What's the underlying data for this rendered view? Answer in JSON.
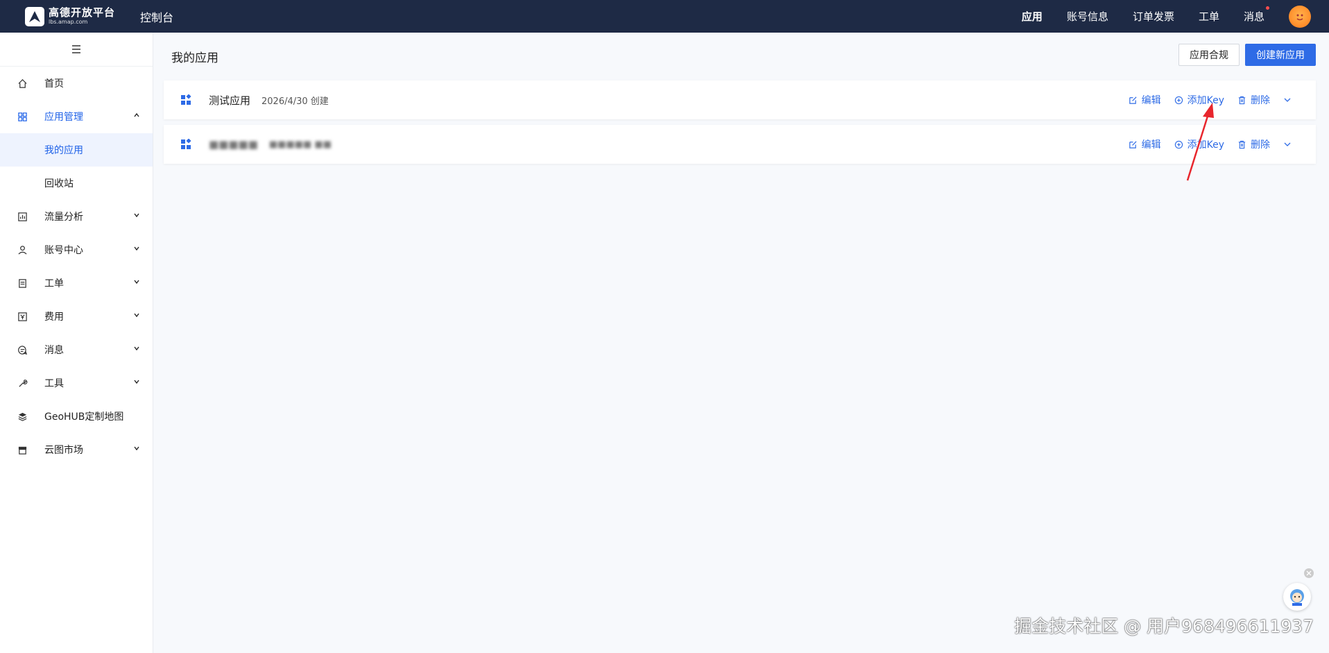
{
  "topbar": {
    "logo_title": "高德开放平台",
    "logo_sub": "lbs.amap.com",
    "console": "控制台",
    "nav": [
      "应用",
      "账号信息",
      "订单发票",
      "工单",
      "消息"
    ]
  },
  "sidebar": {
    "home": "首页",
    "app_mgmt": "应用管理",
    "my_apps": "我的应用",
    "recycle": "回收站",
    "traffic": "流量分析",
    "account": "账号中心",
    "ticket": "工单",
    "fees": "费用",
    "messages": "消息",
    "tools": "工具",
    "geohub": "GeoHUB定制地图",
    "market": "云图市场"
  },
  "main": {
    "title": "我的应用",
    "compliance_btn": "应用合规",
    "create_btn": "创建新应用",
    "apps": [
      {
        "name": "测试应用",
        "date": "2026/4/30 创建"
      },
      {
        "name": "■■■■■",
        "date": "■■■■■ ■■"
      }
    ],
    "actions": {
      "edit": "编辑",
      "add_key": "添加Key",
      "delete": "删除"
    }
  },
  "watermark": "掘金技术社区 @ 用户968496611937",
  "colors": {
    "topbar": "#1e2a45",
    "accent": "#2e6be6",
    "arrow": "#e8262d"
  }
}
